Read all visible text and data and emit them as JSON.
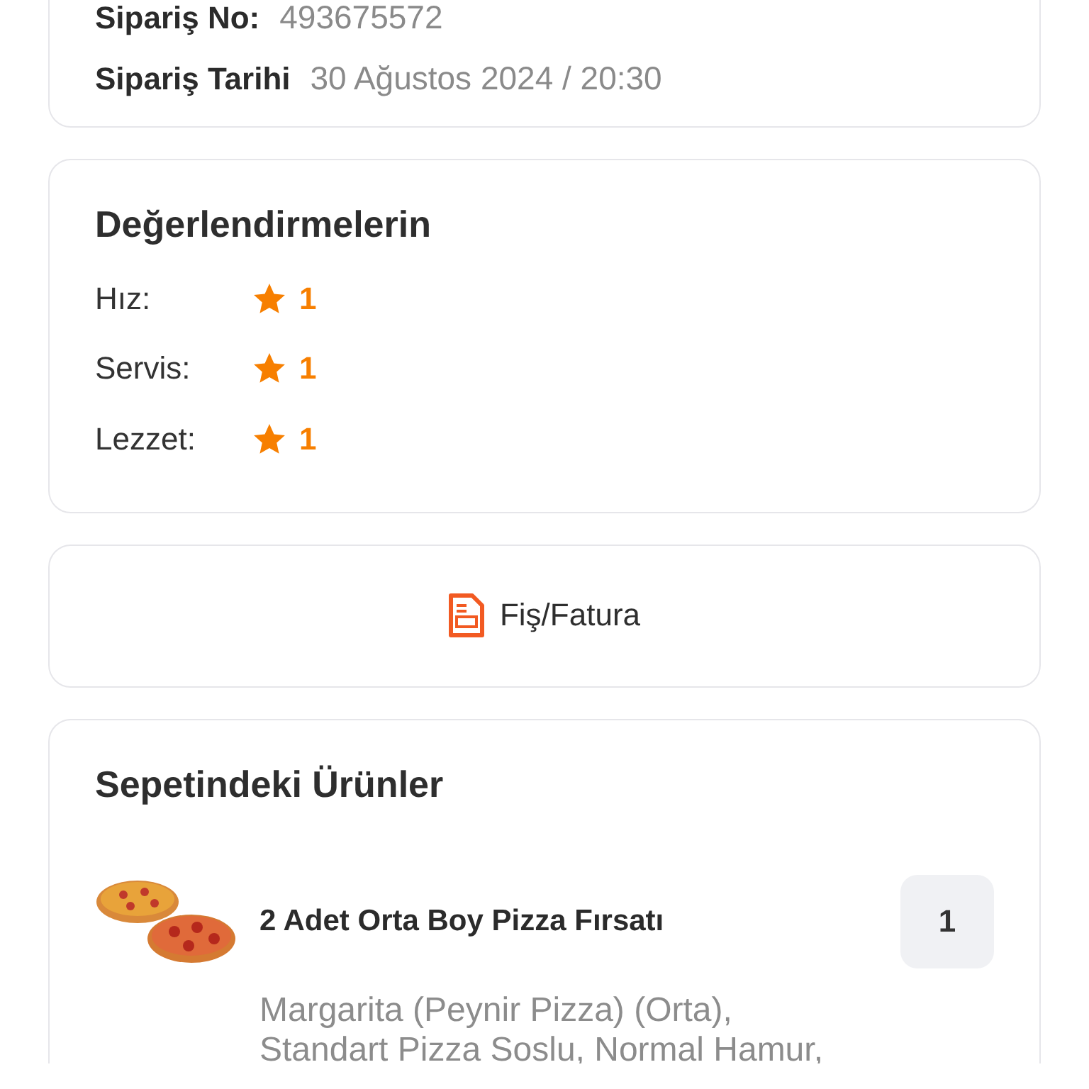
{
  "order_info": {
    "rows": [
      {
        "label": "Sipariş No:",
        "value": "493675572"
      },
      {
        "label": "Sipariş Tarihi",
        "value": "30 Ağustos 2024 / 20:30"
      }
    ]
  },
  "ratings": {
    "title": "Değerlendirmelerin",
    "items": [
      {
        "label": "Hız:",
        "score": "1"
      },
      {
        "label": "Servis:",
        "score": "1"
      },
      {
        "label": "Lezzet:",
        "score": "1"
      }
    ]
  },
  "receipt_button": {
    "label": "Fiş/Fatura"
  },
  "basket": {
    "title": "Sepetindeki Ürünler",
    "items": [
      {
        "name": "2 Adet Orta Boy Pizza Fırsatı",
        "quantity": "1",
        "description": "Margarita (Peynir Pizza) (Orta), Standart Pizza Soslu, Normal Hamur,"
      }
    ]
  }
}
